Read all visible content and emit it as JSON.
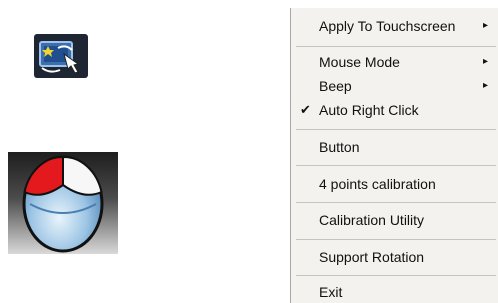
{
  "menu": {
    "items": [
      {
        "label": "Apply To Touchscreen",
        "submenu_arrow": "▸",
        "check": ""
      },
      {
        "label": "Mouse Mode",
        "submenu_arrow": "▸",
        "check": ""
      },
      {
        "label": "Beep",
        "submenu_arrow": "▸",
        "check": ""
      },
      {
        "label": "Auto Right Click",
        "submenu_arrow": "",
        "check": "✔"
      },
      {
        "label": "Button",
        "submenu_arrow": "",
        "check": ""
      },
      {
        "label": "4 points calibration",
        "submenu_arrow": "",
        "check": ""
      },
      {
        "label": "Calibration Utility",
        "submenu_arrow": "",
        "check": ""
      },
      {
        "label": "Support Rotation",
        "submenu_arrow": "",
        "check": ""
      },
      {
        "label": "Exit",
        "submenu_arrow": "",
        "check": ""
      }
    ]
  },
  "icons": {
    "tray": "touchscreen-tray-icon",
    "mouse": "mouse-mode-icon"
  },
  "colors": {
    "menu_background": "#f3f2ee",
    "mouse_left_button": "#e3191d",
    "mouse_body": "#9dc5e5",
    "tray_background": "#1e2634"
  }
}
